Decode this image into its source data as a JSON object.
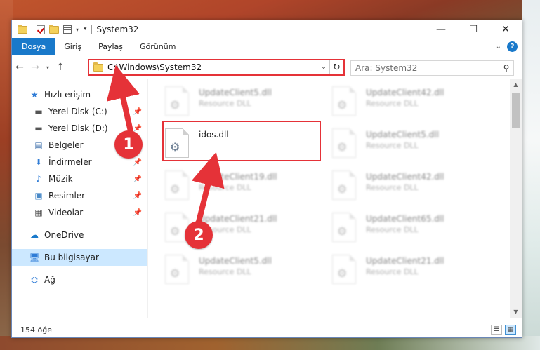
{
  "window": {
    "title": "System32",
    "controls": {
      "minimize": "—",
      "maximize": "☐",
      "close": "✕"
    }
  },
  "ribbon": {
    "tabs": [
      "Dosya",
      "Giriş",
      "Paylaş",
      "Görünüm"
    ],
    "help": "?"
  },
  "nav": {
    "address": "C:\\Windows\\System32",
    "search_placeholder": "Ara: System32"
  },
  "sidebar": {
    "quick_access": "Hızlı erişim",
    "items": [
      {
        "label": "Yerel Disk (C:)",
        "icon": "drive-icon",
        "pinned": true
      },
      {
        "label": "Yerel Disk (D:)",
        "icon": "drive-icon",
        "pinned": true
      },
      {
        "label": "Belgeler",
        "icon": "documents-icon",
        "pinned": true
      },
      {
        "label": "İndirmeler",
        "icon": "download-icon",
        "pinned": true
      },
      {
        "label": "Müzik",
        "icon": "music-icon",
        "pinned": true
      },
      {
        "label": "Resimler",
        "icon": "pictures-icon",
        "pinned": true
      },
      {
        "label": "Videolar",
        "icon": "videos-icon",
        "pinned": true
      }
    ],
    "onedrive": "OneDrive",
    "this_pc": "Bu bilgisayar",
    "network": "Ağ"
  },
  "files": {
    "left_column": [
      {
        "name": "UpdateClient5.dll",
        "type": "Resource DLL"
      },
      {
        "name": "idos.dll",
        "type": ""
      },
      {
        "name": "UpdateClient19.dll",
        "type": "Resource DLL"
      },
      {
        "name": "UpdateClient21.dll",
        "type": "Resource DLL"
      },
      {
        "name": "UpdateClient5.dll",
        "type": "Resource DLL"
      }
    ],
    "right_column": [
      {
        "name": "UpdateClient42.dll",
        "type": "Resource DLL"
      },
      {
        "name": "UpdateClient5.dll",
        "type": "Resource DLL"
      },
      {
        "name": "UpdateClient42.dll",
        "type": "Resource DLL"
      },
      {
        "name": "UpdateClient65.dll",
        "type": "Resource DLL"
      },
      {
        "name": "UpdateClient21.dll",
        "type": "Resource DLL"
      }
    ],
    "highlighted": "idos.dll"
  },
  "status": {
    "count": "154 öğe"
  },
  "annotations": {
    "step1": "1",
    "step2": "2",
    "color": "#e53238"
  }
}
